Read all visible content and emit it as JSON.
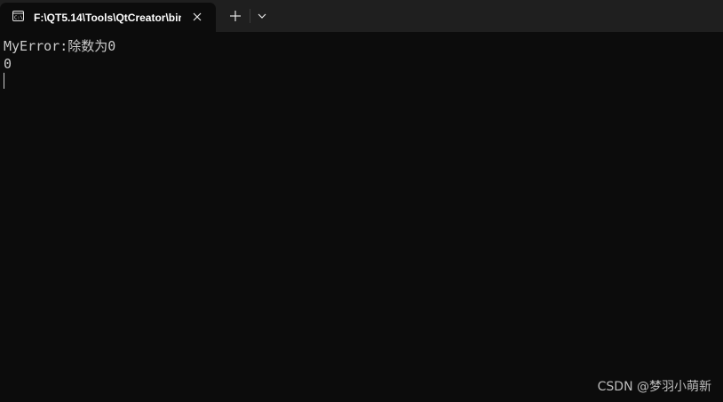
{
  "tab": {
    "title": "F:\\QT5.14\\Tools\\QtCreator\\bin",
    "icon": "terminal-icon",
    "close_icon": "close-icon"
  },
  "toolbar": {
    "new_tab_icon": "plus-icon",
    "dropdown_icon": "chevron-down-icon"
  },
  "terminal": {
    "lines": [
      "MyError:除数为0",
      "0"
    ]
  },
  "watermark": {
    "text": "CSDN @梦羽小萌新"
  },
  "colors": {
    "titlebar_bg": "#1f1f1f",
    "terminal_bg": "#0c0c0c",
    "text": "#cccccc"
  }
}
